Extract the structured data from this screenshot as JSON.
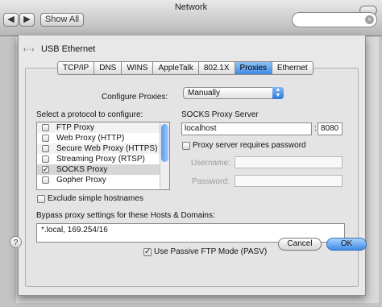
{
  "window": {
    "title": "Network"
  },
  "toolbar": {
    "back": "◀",
    "forward": "▶",
    "show_all": "Show All"
  },
  "sheet": {
    "interface_label": "USB Ethernet",
    "tabs": [
      "TCP/IP",
      "DNS",
      "WINS",
      "AppleTalk",
      "802.1X",
      "Proxies",
      "Ethernet"
    ],
    "active_tab": "Proxies",
    "configure_proxies_label": "Configure Proxies:",
    "configure_proxies_value": "Manually",
    "protocol_label": "Select a protocol to configure:",
    "protocols": [
      {
        "label": "FTP Proxy",
        "checked": false
      },
      {
        "label": "Web Proxy (HTTP)",
        "checked": false
      },
      {
        "label": "Secure Web Proxy (HTTPS)",
        "checked": false
      },
      {
        "label": "Streaming Proxy (RTSP)",
        "checked": false
      },
      {
        "label": "SOCKS Proxy",
        "checked": true
      },
      {
        "label": "Gopher Proxy",
        "checked": false
      }
    ],
    "server_label": "SOCKS Proxy Server",
    "server_value": "localhost",
    "port_value": "8080",
    "requires_password_label": "Proxy server requires password",
    "username_label": "Username:",
    "password_label": "Password:",
    "exclude_simple_label": "Exclude simple hostnames",
    "bypass_label": "Bypass proxy settings for these Hosts & Domains:",
    "bypass_value": "*.local, 169.254/16",
    "passive_ftp_label": "Use Passive FTP Mode (PASV)",
    "help": "?",
    "cancel": "Cancel",
    "ok": "OK"
  }
}
